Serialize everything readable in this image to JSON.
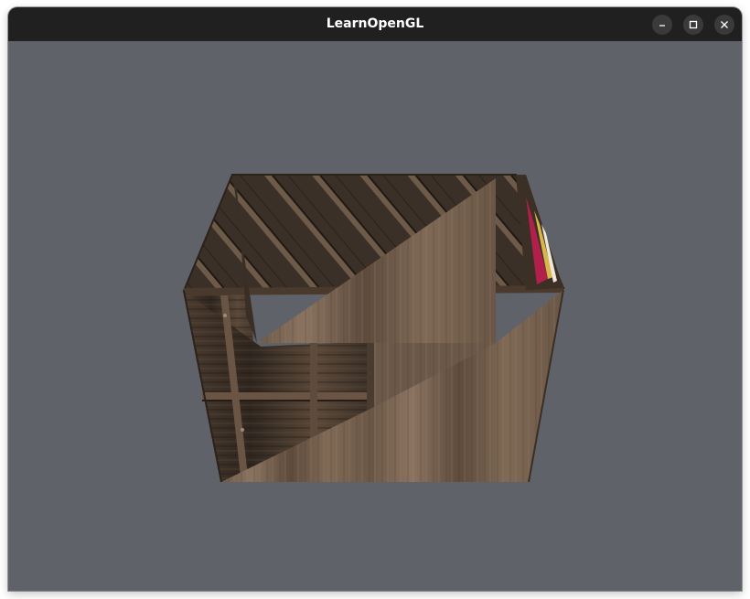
{
  "window": {
    "title": "LearnOpenGL",
    "controls": {
      "minimize_icon": "minimize-icon",
      "maximize_icon": "maximize-icon",
      "close_icon": "close-icon"
    }
  },
  "viewport": {
    "clear_color": "#5f6268",
    "content": "textured-crate-render"
  },
  "colors": {
    "titlebar": "#202020",
    "title_text": "#ffffff",
    "button_bg": "#3a3a3a",
    "wood_dark": "#3d3128",
    "wood_light": "#7a6552",
    "accent_stripe": "#b0204a"
  }
}
